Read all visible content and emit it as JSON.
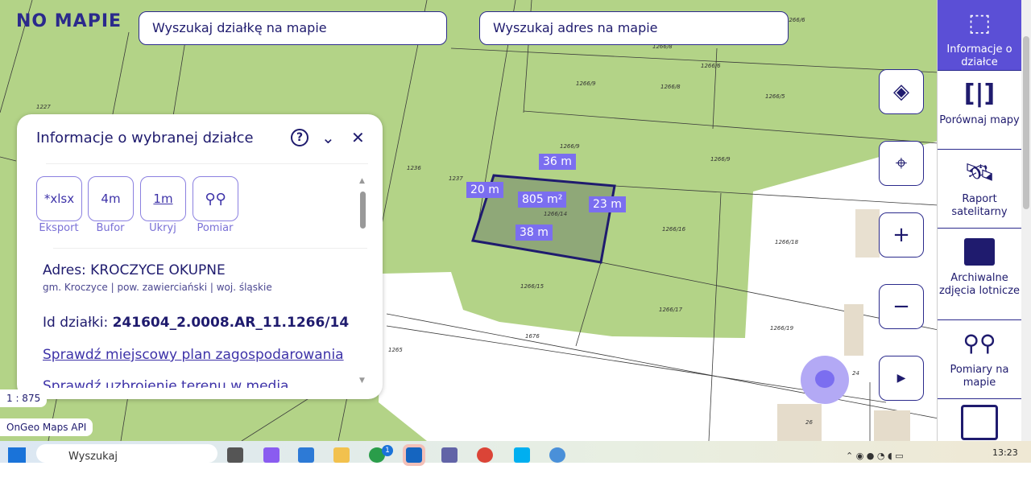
{
  "logo": "NO MAPIE",
  "search": {
    "parcel": "Wyszukaj działkę na mapie",
    "address": "Wyszukaj adres na mapie"
  },
  "panel": {
    "title": "Informacje o wybranej działce",
    "tools": [
      {
        "icon": "*xlsx",
        "label": "Eksport"
      },
      {
        "icon": "4m",
        "label": "Bufor"
      },
      {
        "icon": "1m",
        "label": "Ukryj"
      },
      {
        "icon": "",
        "label": "Pomiar"
      }
    ],
    "address": "Adres: KROCZYCE OKUPNE",
    "admin": "gm. Kroczyce | pow. zawierciański | woj. śląskie",
    "id_label": "Id działki: ",
    "id_value": "241604_2.0008.AR_11.1266/14",
    "link_plan": "Sprawdź miejscowy plan zagospodarowania",
    "link_media": "Sprawdź uzbrojenie terenu w media"
  },
  "map": {
    "measurements": {
      "top": "36 m",
      "left": "20 m",
      "right": "23 m",
      "bottom": "38 m",
      "area": "805 m²"
    },
    "parcels": [
      "1227",
      "1236",
      "1237",
      "1266/9",
      "1266/8",
      "1266/5",
      "1266/9",
      "1266/9",
      "1266/14",
      "1266/16",
      "1266/18",
      "1266/15",
      "1266/17",
      "1266/19",
      "1676",
      "1265",
      "24",
      "26",
      "1266/6",
      "1266/8",
      "1266/6"
    ],
    "scale": "1 : 875",
    "attribution": "OnGeo Maps API"
  },
  "sidebar": [
    "Informacje o działce",
    "Porównaj mapy",
    "Raport satelitarny",
    "Archiwalne zdjęcia lotnicze",
    "Pomiary na mapie"
  ],
  "taskbar": {
    "search": "Wyszukaj",
    "time": "13:23",
    "badge": "1"
  },
  "colors": {
    "accent": "#5b4fd6",
    "navy": "#1f1b6e",
    "green": "#b3d387"
  }
}
